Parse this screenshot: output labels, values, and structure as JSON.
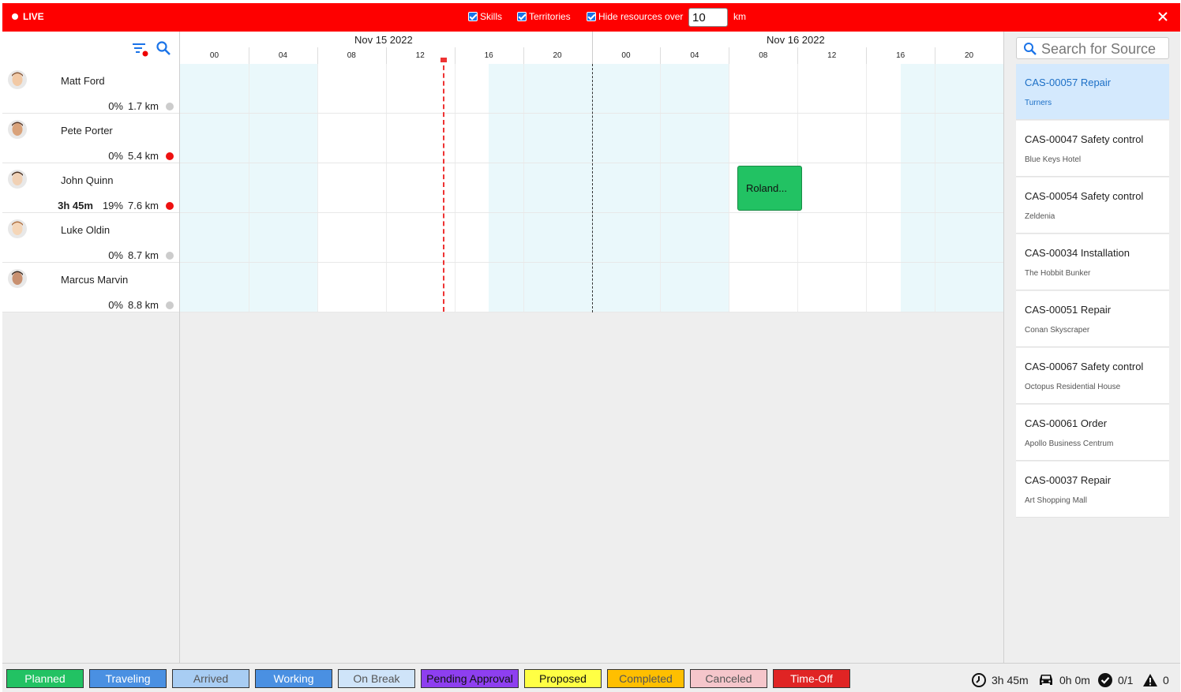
{
  "topbar": {
    "live_label": "LIVE",
    "skills_label": "Skills",
    "territories_label": "Territories",
    "hide_label": "Hide resources over",
    "km_value": "10",
    "km_unit": "km"
  },
  "timeline": {
    "days": [
      "Nov 15 2022",
      "Nov 16 2022"
    ],
    "hours": [
      "00",
      "04",
      "08",
      "12",
      "16",
      "20"
    ]
  },
  "resources": [
    {
      "name": "Matt Ford",
      "time": "",
      "pct": "0%",
      "dist": "1.7 km",
      "status_color": "#cccccc"
    },
    {
      "name": "Pete Porter",
      "time": "",
      "pct": "0%",
      "dist": "5.4 km",
      "status_color": "#ee1111"
    },
    {
      "name": "John Quinn",
      "time": "3h 45m",
      "pct": "19%",
      "dist": "7.6 km",
      "status_color": "#ee1111"
    },
    {
      "name": "Luke Oldin",
      "time": "",
      "pct": "0%",
      "dist": "8.7 km",
      "status_color": "#cccccc"
    },
    {
      "name": "Marcus Marvin",
      "time": "",
      "pct": "0%",
      "dist": "8.8 km",
      "status_color": "#cccccc"
    }
  ],
  "job": {
    "label": "Roland..."
  },
  "source_search": {
    "placeholder": "Search for Source"
  },
  "cases": [
    {
      "title": "CAS-00057 Repair",
      "sub": "Turners",
      "selected": true
    },
    {
      "title": "CAS-00047 Safety control",
      "sub": "Blue Keys Hotel"
    },
    {
      "title": "CAS-00054 Safety control",
      "sub": "Zeldenia"
    },
    {
      "title": "CAS-00034 Installation",
      "sub": "The Hobbit Bunker"
    },
    {
      "title": "CAS-00051 Repair",
      "sub": "Conan Skyscraper"
    },
    {
      "title": "CAS-00067 Safety control",
      "sub": "Octopus Residential House"
    },
    {
      "title": "CAS-00061 Order",
      "sub": "Apollo Business Centrum"
    },
    {
      "title": "CAS-00037 Repair",
      "sub": "Art Shopping Mall"
    }
  ],
  "legend": [
    {
      "label": "Planned",
      "bg": "#22c263",
      "fg": "#ffffff"
    },
    {
      "label": "Traveling",
      "bg": "#4a90e2",
      "fg": "#ffffff"
    },
    {
      "label": "Arrived",
      "bg": "#a8cdf3",
      "fg": "#555555"
    },
    {
      "label": "Working",
      "bg": "#4a90e2",
      "fg": "#ffffff"
    },
    {
      "label": "On Break",
      "bg": "#cfe4f9",
      "fg": "#555555"
    },
    {
      "label": "Pending Approval",
      "bg": "#8e3ff0",
      "fg": "#111111"
    },
    {
      "label": "Proposed",
      "bg": "#ffff44",
      "fg": "#111111"
    },
    {
      "label": "Completed",
      "bg": "#ffbf00",
      "fg": "#555555"
    },
    {
      "label": "Canceled",
      "bg": "#f5c6cb",
      "fg": "#555555"
    },
    {
      "label": "Time-Off",
      "bg": "#e02424",
      "fg": "#ffffff"
    }
  ],
  "stats": {
    "time": "3h 45m",
    "travel": "0h 0m",
    "done": "0/1",
    "warnings": "0"
  }
}
